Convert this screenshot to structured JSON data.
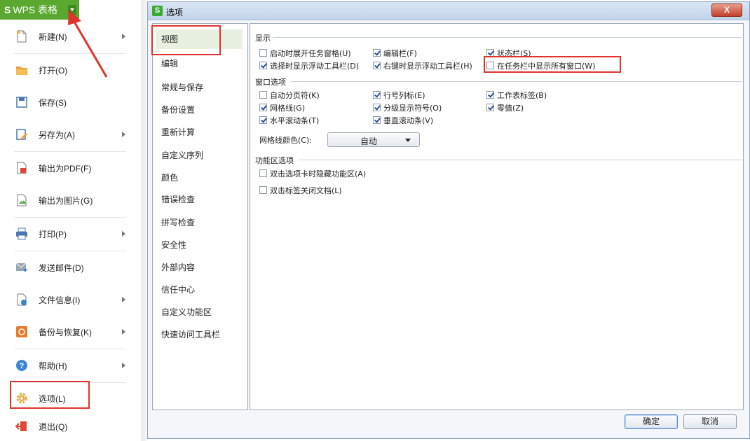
{
  "app": {
    "title": "WPS 表格",
    "logo": "S"
  },
  "menu": {
    "items": [
      {
        "label": "新建(N)",
        "icon": "new-file-icon",
        "submenu": true
      },
      {
        "label": "打开(O)",
        "icon": "open-folder-icon",
        "submenu": false
      },
      {
        "label": "保存(S)",
        "icon": "save-icon",
        "submenu": false
      },
      {
        "label": "另存为(A)",
        "icon": "save-as-icon",
        "submenu": true
      },
      {
        "label": "输出为PDF(F)",
        "icon": "pdf-export-icon",
        "submenu": false
      },
      {
        "label": "输出为图片(G)",
        "icon": "image-export-icon",
        "submenu": false
      },
      {
        "label": "打印(P)",
        "icon": "printer-icon",
        "submenu": true
      },
      {
        "label": "发送邮件(D)",
        "icon": "mail-icon",
        "submenu": false
      },
      {
        "label": "文件信息(I)",
        "icon": "file-info-icon",
        "submenu": true
      },
      {
        "label": "备份与恢复(K)",
        "icon": "backup-icon",
        "submenu": true
      },
      {
        "label": "帮助(H)",
        "icon": "help-icon",
        "submenu": true
      },
      {
        "label": "选项(L)",
        "icon": "gear-icon",
        "submenu": false
      },
      {
        "label": "退出(Q)",
        "icon": "exit-icon",
        "submenu": false
      }
    ]
  },
  "dialog": {
    "title": "选项",
    "close_label": "X",
    "nav": [
      "视图",
      "编辑",
      "常规与保存",
      "备份设置",
      "重新计算",
      "自定义序列",
      "颜色",
      "错误检查",
      "拼写检查",
      "安全性",
      "外部内容",
      "信任中心",
      "自定义功能区",
      "快速访问工具栏"
    ],
    "nav_selected": "视图",
    "groups": {
      "display": {
        "title": "显示",
        "options": [
          {
            "label": "启动时展开任务窗格(U)",
            "checked": false
          },
          {
            "label": "编辑栏(F)",
            "checked": true
          },
          {
            "label": "状态栏(S)",
            "checked": true
          },
          {
            "label": "选择时显示浮动工具栏(D)",
            "checked": true
          },
          {
            "label": "右键时显示浮动工具栏(H)",
            "checked": true
          },
          {
            "label": "在任务栏中显示所有窗口(W)",
            "checked": false
          }
        ]
      },
      "window": {
        "title": "窗口选项",
        "options": [
          {
            "label": "自动分页符(K)",
            "checked": false
          },
          {
            "label": "行号列标(E)",
            "checked": true
          },
          {
            "label": "工作表标签(B)",
            "checked": true
          },
          {
            "label": "网格线(G)",
            "checked": true
          },
          {
            "label": "分级显示符号(O)",
            "checked": true
          },
          {
            "label": "零值(Z)",
            "checked": true
          },
          {
            "label": "水平滚动条(T)",
            "checked": true
          },
          {
            "label": "垂直滚动条(V)",
            "checked": true
          }
        ],
        "gridline_color_label": "网格线颜色(C):",
        "gridline_color_value": "自动"
      },
      "ribbon": {
        "title": "功能区选项",
        "options": [
          {
            "label": "双击选项卡时隐藏功能区(A)",
            "checked": false
          },
          {
            "label": "双击标签关闭文档(L)",
            "checked": false
          }
        ]
      }
    },
    "ok_label": "确定",
    "cancel_label": "取消"
  },
  "colors": {
    "wps_green": "#5aa82f",
    "highlight_red": "#e0332e"
  }
}
